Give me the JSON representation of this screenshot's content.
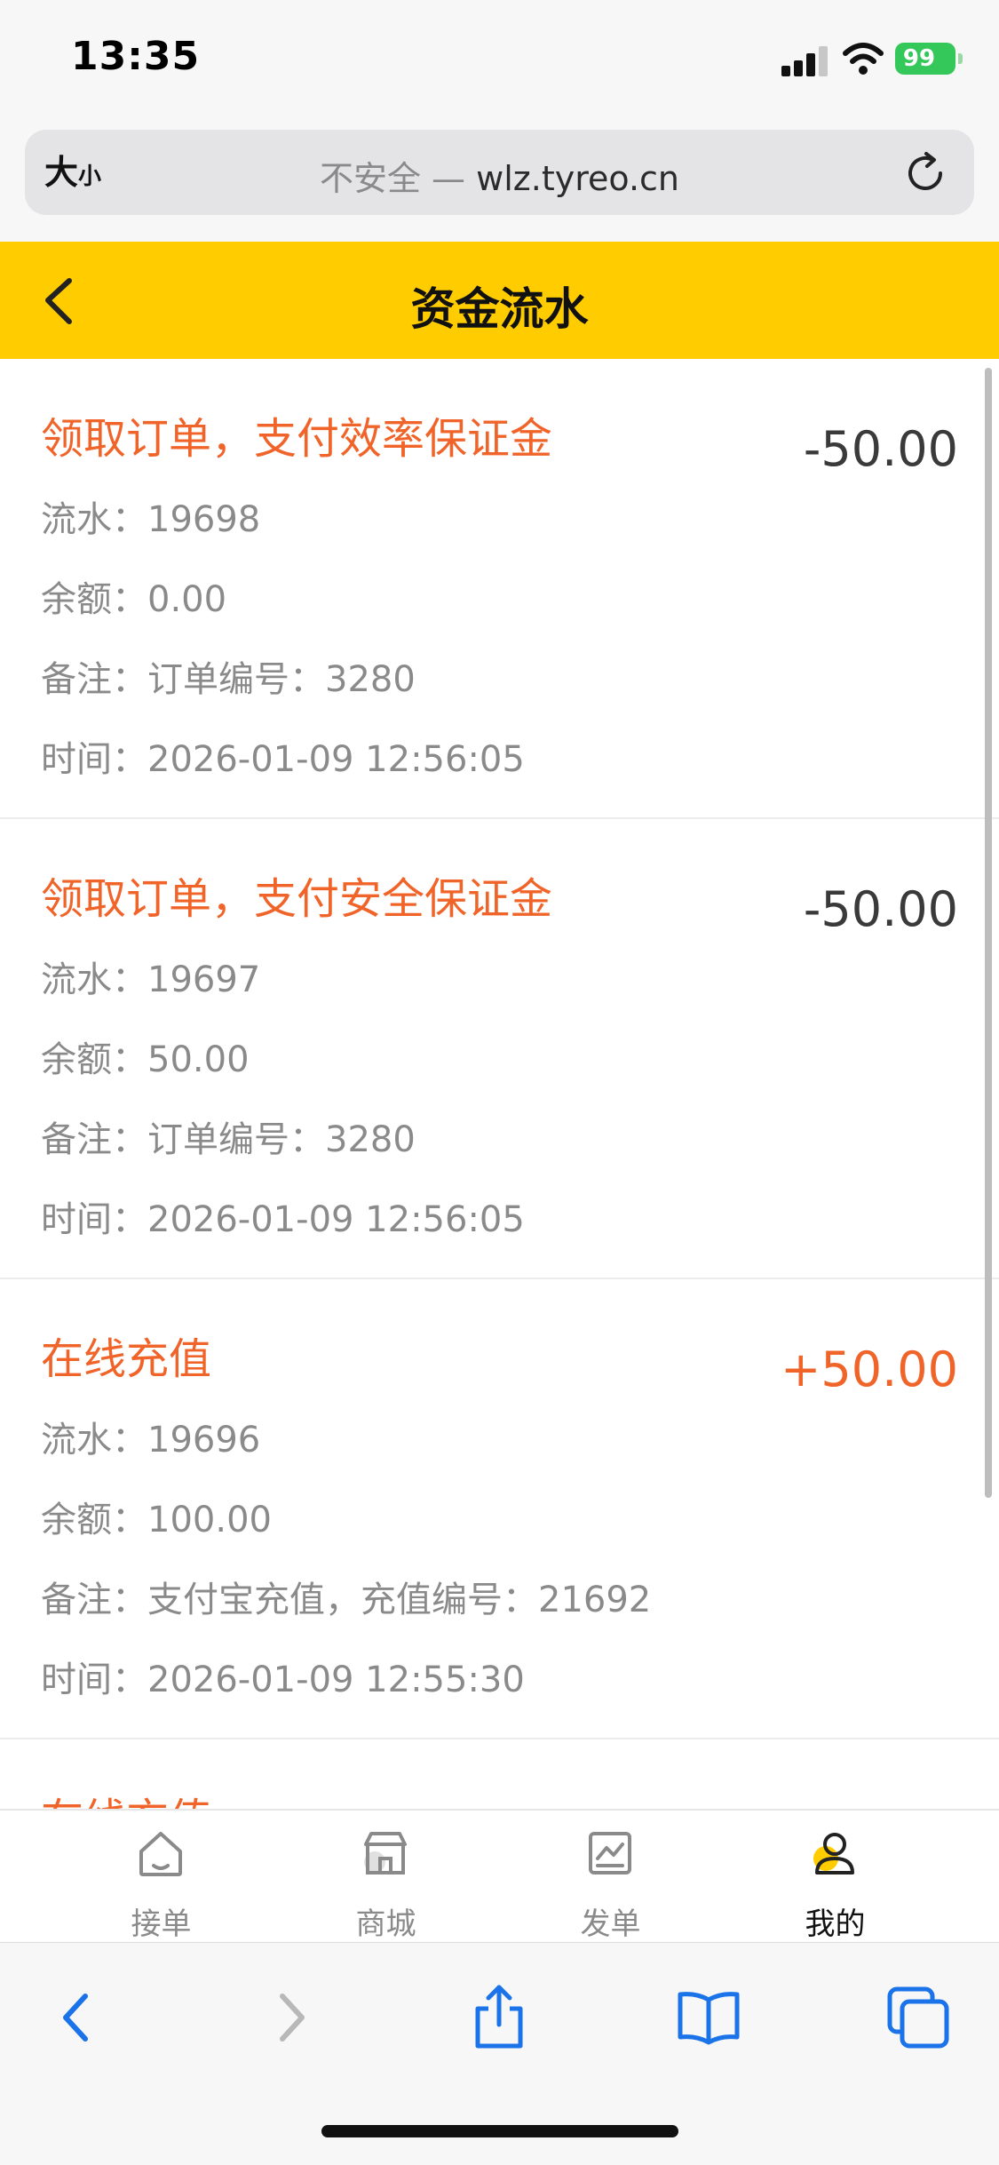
{
  "status_bar": {
    "time": "13:35",
    "battery": "99"
  },
  "browser": {
    "text_size_big": "大",
    "text_size_small": "小",
    "insecure_label": "不安全 —",
    "host": "wlz.tyreo.cn"
  },
  "header": {
    "title": "资金流水"
  },
  "labels": {
    "serial": "流水：",
    "balance": "余额：",
    "note": "备注：",
    "time": "时间："
  },
  "records": [
    {
      "title": "领取订单，支付效率保证金",
      "amount": "-50.00",
      "serial": "19698",
      "balance": "0.00",
      "note": "订单编号：3280",
      "time": "2026-01-09 12:56:05"
    },
    {
      "title": "领取订单，支付安全保证金",
      "amount": "-50.00",
      "serial": "19697",
      "balance": "50.00",
      "note": "订单编号：3280",
      "time": "2026-01-09 12:56:05"
    },
    {
      "title": "在线充值",
      "amount": "+50.00",
      "serial": "19696",
      "balance": "100.00",
      "note": "支付宝充值，充值编号：21692",
      "time": "2026-01-09 12:55:30"
    },
    {
      "title": "在线充值"
    }
  ],
  "tabs": [
    {
      "label": "接单",
      "icon": "home-icon"
    },
    {
      "label": "商城",
      "icon": "store-icon"
    },
    {
      "label": "发单",
      "icon": "chart-icon"
    },
    {
      "label": "我的",
      "icon": "user-icon",
      "active": true
    }
  ],
  "colors": {
    "accent": "#ffcc00",
    "title_orange": "#f0642a",
    "safari_blue": "#1a73e8"
  }
}
